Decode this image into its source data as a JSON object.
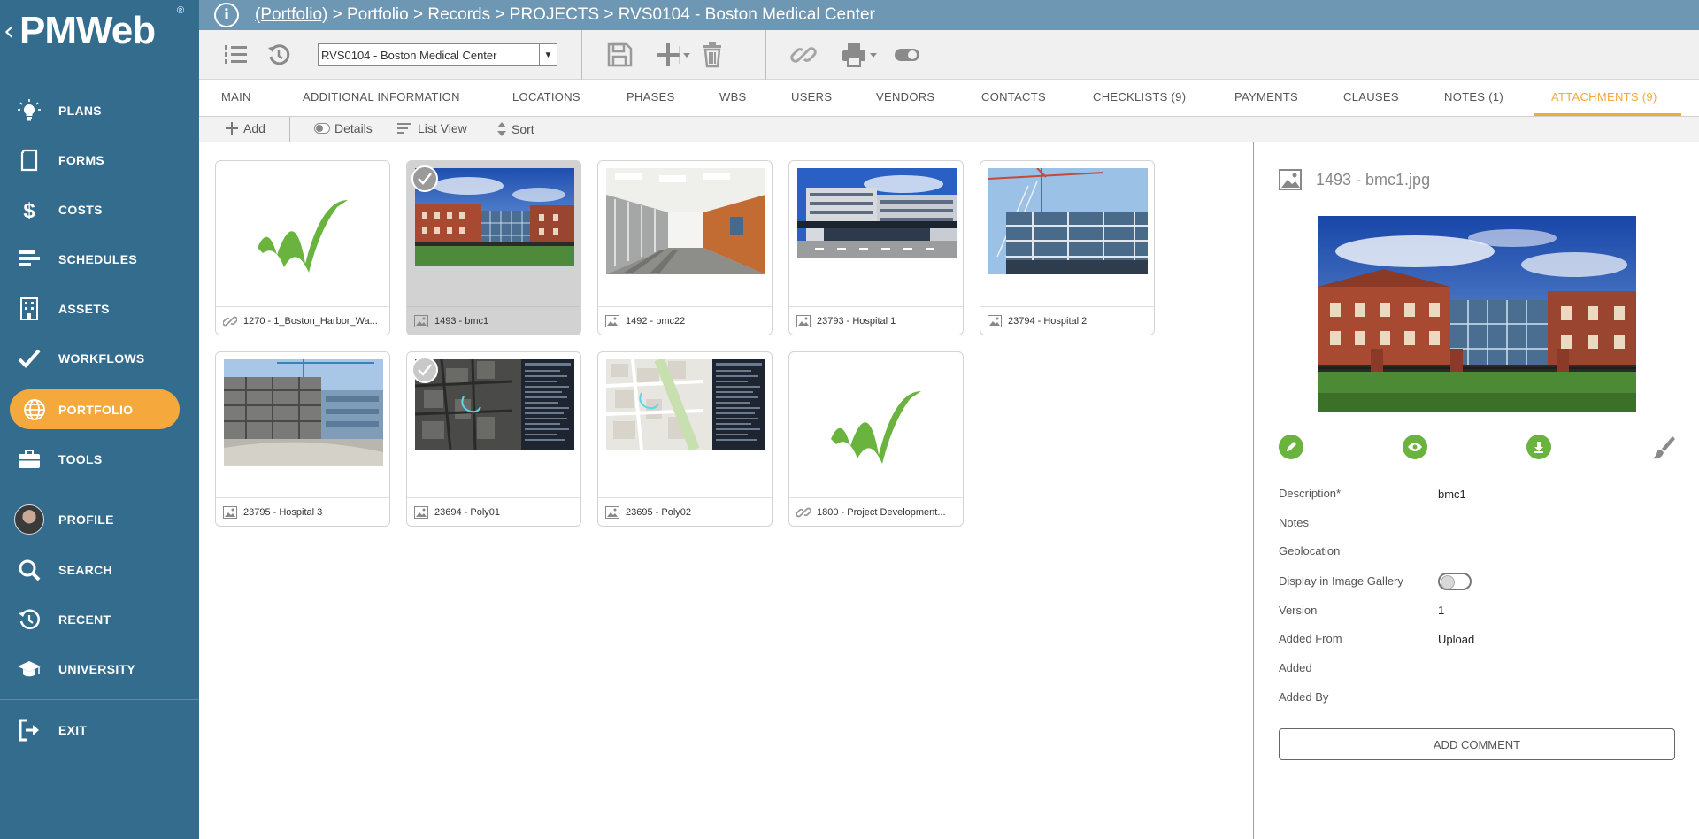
{
  "app": {
    "logo_text": "PMWeb",
    "logo_mark": "®"
  },
  "breadcrumb": {
    "root_link": "(Portfolio)",
    "path": " > Portfolio > Records > PROJECTS > RVS0104 - Boston Medical Center"
  },
  "sidebar": {
    "items": [
      {
        "label": "PLANS",
        "icon": "lightbulb-icon"
      },
      {
        "label": "FORMS",
        "icon": "forms-icon"
      },
      {
        "label": "COSTS",
        "icon": "dollar-icon"
      },
      {
        "label": "SCHEDULES",
        "icon": "schedule-bars-icon"
      },
      {
        "label": "ASSETS",
        "icon": "building-icon"
      },
      {
        "label": "WORKFLOWS",
        "icon": "checkmark-icon"
      },
      {
        "label": "PORTFOLIO",
        "icon": "globe-icon",
        "active": true
      },
      {
        "label": "TOOLS",
        "icon": "briefcase-icon"
      },
      {
        "label": "PROFILE",
        "icon": "avatar"
      },
      {
        "label": "SEARCH",
        "icon": "search-icon"
      },
      {
        "label": "RECENT",
        "icon": "history-icon"
      },
      {
        "label": "UNIVERSITY",
        "icon": "graduation-cap-icon"
      },
      {
        "label": "EXIT",
        "icon": "exit-icon"
      }
    ]
  },
  "toolbar": {
    "record_selector_value": "RVS0104 - Boston Medical Center"
  },
  "tabs": [
    {
      "label": "MAIN"
    },
    {
      "label": "ADDITIONAL INFORMATION"
    },
    {
      "label": "LOCATIONS"
    },
    {
      "label": "PHASES"
    },
    {
      "label": "WBS"
    },
    {
      "label": "USERS"
    },
    {
      "label": "VENDORS"
    },
    {
      "label": "CONTACTS"
    },
    {
      "label": "CHECKLISTS (9)"
    },
    {
      "label": "PAYMENTS"
    },
    {
      "label": "CLAUSES"
    },
    {
      "label": "NOTES (1)"
    },
    {
      "label": "ATTACHMENTS (9)",
      "active": true
    }
  ],
  "subbar": {
    "add": "Add",
    "details": "Details",
    "list_view": "List View",
    "sort": "Sort"
  },
  "attachments": [
    {
      "caption": "1270 - 1_Boston_Harbor_Wa...",
      "type": "link",
      "thumb": "logo"
    },
    {
      "caption": "1493 - bmc1",
      "type": "image",
      "thumb": "brick-building",
      "selected": true
    },
    {
      "caption": "1492 - bmc22",
      "type": "image",
      "thumb": "corridor"
    },
    {
      "caption": "23793 - Hospital 1",
      "type": "image",
      "thumb": "hospital-facade"
    },
    {
      "caption": "23794 - Hospital 2",
      "type": "image",
      "thumb": "construction-crane"
    },
    {
      "caption": "23795 - Hospital 3",
      "type": "image",
      "thumb": "construction-site"
    },
    {
      "caption": "23694 - Poly01",
      "type": "image",
      "thumb": "aerial-dark",
      "checked": true
    },
    {
      "caption": "23695 - Poly02",
      "type": "image",
      "thumb": "map-light"
    },
    {
      "caption": "1800 - Project Development...",
      "type": "link",
      "thumb": "logo"
    }
  ],
  "detail": {
    "title": "1493 - bmc1.jpg",
    "fields": [
      {
        "label": "Description*",
        "value": "bmc1"
      },
      {
        "label": "Notes",
        "value": ""
      },
      {
        "label": "Geolocation",
        "value": ""
      },
      {
        "label": "Display in Image Gallery",
        "value": "",
        "toggle": false
      },
      {
        "label": "Version",
        "value": "1"
      },
      {
        "label": "Added From",
        "value": "Upload"
      },
      {
        "label": "Added",
        "value": ""
      },
      {
        "label": "Added By",
        "value": ""
      }
    ],
    "add_comment": "ADD COMMENT"
  },
  "colors": {
    "sidebar": "#346c8e",
    "accent": "#f5a93c",
    "green": "#6ab33e",
    "crumbbar": "#6d97b3"
  }
}
